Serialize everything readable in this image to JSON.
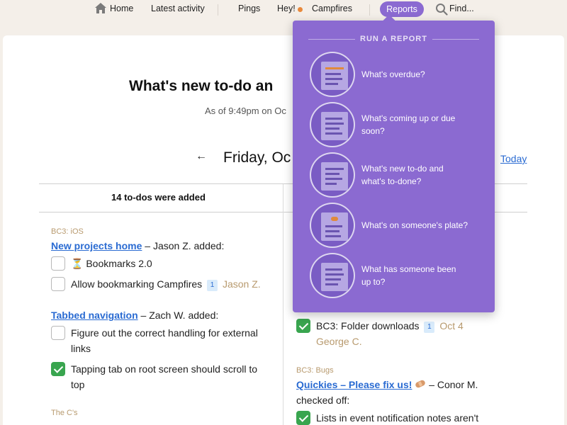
{
  "nav": {
    "home": "Home",
    "latest_activity": "Latest activity",
    "pings": "Pings",
    "hey": "Hey!",
    "campfires": "Campfires",
    "reports": "Reports",
    "find": "Find...",
    "hey_dot_color": "#e8893c"
  },
  "page": {
    "title": "What's new to-do an",
    "as_of": "As of 9:49pm on Oc",
    "back_icon": "←",
    "day": "Friday, Oc",
    "today": "Today"
  },
  "left_column": {
    "header": "14 to-dos were added",
    "groups": [
      {
        "project": "BC3: iOS",
        "list_name": "New projects home",
        "suffix": " – Jason Z. added:",
        "todos": [
          {
            "icon": "hourglass-icon",
            "icon_glyph": "⏳",
            "text": "Bookmarks 2.0",
            "checked": false
          },
          {
            "text": "Allow bookmarking Campfires",
            "comments": "1",
            "meta": "Jason Z.",
            "checked": false
          }
        ]
      },
      {
        "list_name": "Tabbed navigation",
        "suffix": " – Zach W. added:",
        "todos": [
          {
            "text_line1": "Figure out the correct handling for external",
            "text_line2": "links",
            "checked": false
          },
          {
            "text_line1": "Tapping tab on root screen should scroll to",
            "text_line2": "top",
            "checked": true
          }
        ]
      },
      {
        "project": "The C's"
      }
    ]
  },
  "right_column": {
    "todo_folder": {
      "text": "BC3: Folder downloads",
      "comments": "1",
      "date": "Oct 4",
      "meta": "George C.",
      "checked": true
    },
    "project": "BC3: Bugs",
    "list_name": "Quickies – Please fix us!",
    "list_icon": "bandage-icon",
    "suffix": " – Conor M.",
    "suffix2": "checked off:",
    "todo": {
      "text": "Lists in event notification notes aren't",
      "checked": true
    }
  },
  "reports_menu": {
    "heading": "RUN A REPORT",
    "items": [
      {
        "label": "What's overdue?"
      },
      {
        "label": "What's coming up or due soon?"
      },
      {
        "label": "What's new to-do and what's to-done?"
      },
      {
        "label": "What's on someone's plate?"
      },
      {
        "label": "What has someone been up to?"
      }
    ]
  },
  "colors": {
    "accent_purple": "#8b6ad1",
    "link_blue": "#2a6bd2",
    "check_green": "#39a54f",
    "meta_tan": "#b89a6e"
  }
}
